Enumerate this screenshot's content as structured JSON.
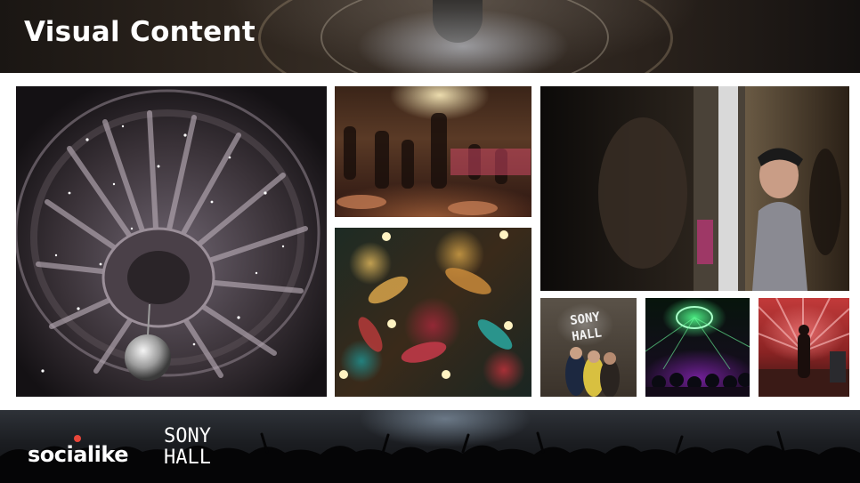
{
  "header": {
    "title": "Visual Content"
  },
  "footer": {
    "logo_socialike": "socialike",
    "logo_sony_line1": "SONY",
    "logo_sony_line2": "HALL"
  },
  "tiles": {
    "sony_wall_line1": "SONY",
    "sony_wall_line2": "HALL"
  },
  "colors": {
    "background": "#ffffff",
    "title_text": "#ffffff",
    "socialike_accent": "#e8463a"
  }
}
